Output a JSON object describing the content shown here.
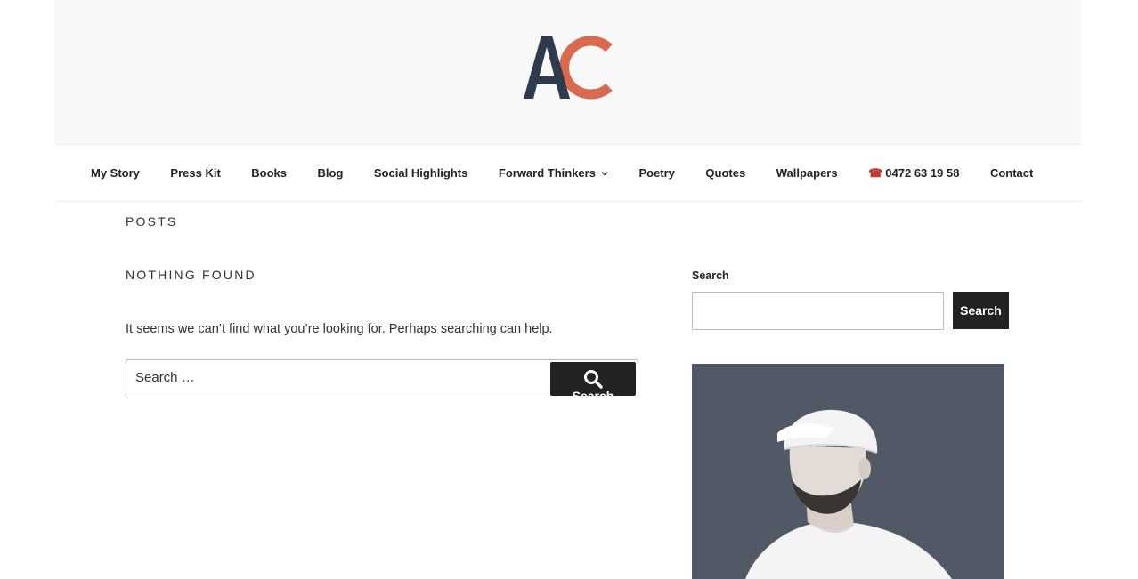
{
  "brand": {
    "logo_text": "AC",
    "colors": {
      "navy": "#2e3a4e",
      "coral": "#d96a4d",
      "header_bg": "#f8f8f8",
      "button_bg": "#222222",
      "image_bg": "#525966"
    }
  },
  "nav": {
    "items": [
      {
        "label": "My Story"
      },
      {
        "label": "Press Kit"
      },
      {
        "label": "Books"
      },
      {
        "label": "Blog"
      },
      {
        "label": "Social Highlights"
      },
      {
        "label": "Forward Thinkers",
        "icon": "chevron-down-icon"
      },
      {
        "label": "Poetry"
      },
      {
        "label": "Quotes"
      },
      {
        "label": "Wallpapers"
      },
      {
        "label": "0472 63 19 58",
        "icon": "phone-icon",
        "icon_glyph": "☎"
      },
      {
        "label": "Contact"
      }
    ]
  },
  "main": {
    "page_title": "POSTS",
    "section_title": "NOTHING FOUND",
    "message": "It seems we can’t find what you’re looking for. Perhaps searching can help.",
    "search": {
      "placeholder": "Search …",
      "button_label": "Search",
      "button_icon": "search-icon"
    }
  },
  "sidebar": {
    "search_widget": {
      "title": "Search",
      "input_value": "",
      "button_label": "Search"
    },
    "image": {
      "description_icon": "person-photo"
    }
  }
}
